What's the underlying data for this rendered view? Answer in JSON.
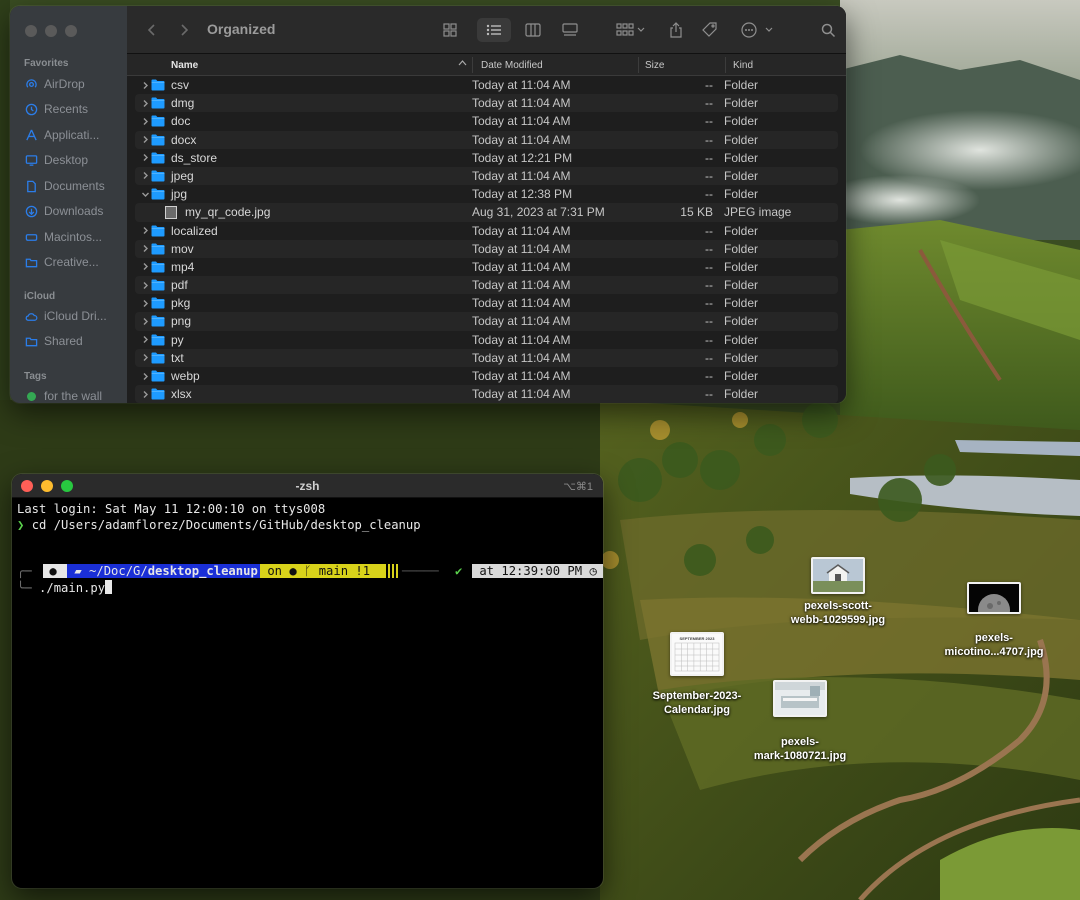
{
  "finder": {
    "title": "Organized",
    "sidebar": {
      "favorites_header": "Favorites",
      "favorites": [
        {
          "label": "AirDrop",
          "icon": "airdrop-icon"
        },
        {
          "label": "Recents",
          "icon": "clock-icon"
        },
        {
          "label": "Applicati...",
          "icon": "applications-icon"
        },
        {
          "label": "Desktop",
          "icon": "desktop-icon"
        },
        {
          "label": "Documents",
          "icon": "document-icon"
        },
        {
          "label": "Downloads",
          "icon": "download-icon"
        },
        {
          "label": "Macintos...",
          "icon": "disk-icon"
        },
        {
          "label": "Creative...",
          "icon": "folder-icon"
        }
      ],
      "icloud_header": "iCloud",
      "icloud": [
        {
          "label": "iCloud Dri...",
          "icon": "cloud-icon"
        },
        {
          "label": "Shared",
          "icon": "shared-folder-icon"
        }
      ],
      "tags_header": "Tags",
      "tags": [
        {
          "label": "for the wall",
          "color": "#34a853"
        }
      ]
    },
    "columns": {
      "name": "Name",
      "date": "Date Modified",
      "size": "Size",
      "kind": "Kind"
    },
    "rows": [
      {
        "name": "csv",
        "date": "Today at 11:04 AM",
        "size": "--",
        "kind": "Folder",
        "type": "folder",
        "expanded": false
      },
      {
        "name": "dmg",
        "date": "Today at 11:04 AM",
        "size": "--",
        "kind": "Folder",
        "type": "folder",
        "expanded": false
      },
      {
        "name": "doc",
        "date": "Today at 11:04 AM",
        "size": "--",
        "kind": "Folder",
        "type": "folder",
        "expanded": false
      },
      {
        "name": "docx",
        "date": "Today at 11:04 AM",
        "size": "--",
        "kind": "Folder",
        "type": "folder",
        "expanded": false
      },
      {
        "name": "ds_store",
        "date": "Today at 12:21 PM",
        "size": "--",
        "kind": "Folder",
        "type": "folder",
        "expanded": false
      },
      {
        "name": "jpeg",
        "date": "Today at 11:04 AM",
        "size": "--",
        "kind": "Folder",
        "type": "folder",
        "expanded": false
      },
      {
        "name": "jpg",
        "date": "Today at 12:38 PM",
        "size": "--",
        "kind": "Folder",
        "type": "folder",
        "expanded": true
      },
      {
        "name": "my_qr_code.jpg",
        "date": "Aug 31, 2023 at 7:31 PM",
        "size": "15 KB",
        "kind": "JPEG image",
        "type": "file",
        "expanded": false
      },
      {
        "name": "localized",
        "date": "Today at 11:04 AM",
        "size": "--",
        "kind": "Folder",
        "type": "folder",
        "expanded": false
      },
      {
        "name": "mov",
        "date": "Today at 11:04 AM",
        "size": "--",
        "kind": "Folder",
        "type": "folder",
        "expanded": false
      },
      {
        "name": "mp4",
        "date": "Today at 11:04 AM",
        "size": "--",
        "kind": "Folder",
        "type": "folder",
        "expanded": false
      },
      {
        "name": "pdf",
        "date": "Today at 11:04 AM",
        "size": "--",
        "kind": "Folder",
        "type": "folder",
        "expanded": false
      },
      {
        "name": "pkg",
        "date": "Today at 11:04 AM",
        "size": "--",
        "kind": "Folder",
        "type": "folder",
        "expanded": false
      },
      {
        "name": "png",
        "date": "Today at 11:04 AM",
        "size": "--",
        "kind": "Folder",
        "type": "folder",
        "expanded": false
      },
      {
        "name": "py",
        "date": "Today at 11:04 AM",
        "size": "--",
        "kind": "Folder",
        "type": "folder",
        "expanded": false
      },
      {
        "name": "txt",
        "date": "Today at 11:04 AM",
        "size": "--",
        "kind": "Folder",
        "type": "folder",
        "expanded": false
      },
      {
        "name": "webp",
        "date": "Today at 11:04 AM",
        "size": "--",
        "kind": "Folder",
        "type": "folder",
        "expanded": false
      },
      {
        "name": "xlsx",
        "date": "Today at 11:04 AM",
        "size": "--",
        "kind": "Folder",
        "type": "folder",
        "expanded": false
      }
    ]
  },
  "terminal": {
    "title": "-zsh",
    "shortcut": "⌥⌘1",
    "login_line": "Last login: Sat May 11 12:00:10 on ttys008",
    "prompt_symbol": "❯",
    "cd_command": "cd /Users/adamflorez/Documents/GitHub/desktop_cleanup",
    "prompt": {
      "path_prefix": "~/Doc/G/",
      "path_current": "desktop_cleanup",
      "git_on": "on",
      "branch": "main",
      "git_status": "!1",
      "check": "✔",
      "time_at": "at",
      "time": "12:39:00 PM"
    },
    "current_command": "./main.py"
  },
  "desktop_icons": [
    {
      "label_line1": "pexels-scott-",
      "label_line2": "webb-1029599.jpg"
    },
    {
      "label_line1": "pexels-",
      "label_line2": "micotino...4707.jpg"
    },
    {
      "label_line1": "September-2023-",
      "label_line2": "Calendar.jpg",
      "thumb_text": "SEPTEMBER 2023"
    },
    {
      "label_line1": "pexels-",
      "label_line2": "mark-1080721.jpg"
    }
  ],
  "colors": {
    "folder_blue": "#1e9bff",
    "prompt_blue": "#1a2fd6",
    "prompt_yellow": "#d8d21a",
    "check_green": "#5ad04c",
    "traffic_red": "#ff5f57",
    "traffic_yellow": "#febc2e",
    "traffic_green": "#28c840"
  }
}
